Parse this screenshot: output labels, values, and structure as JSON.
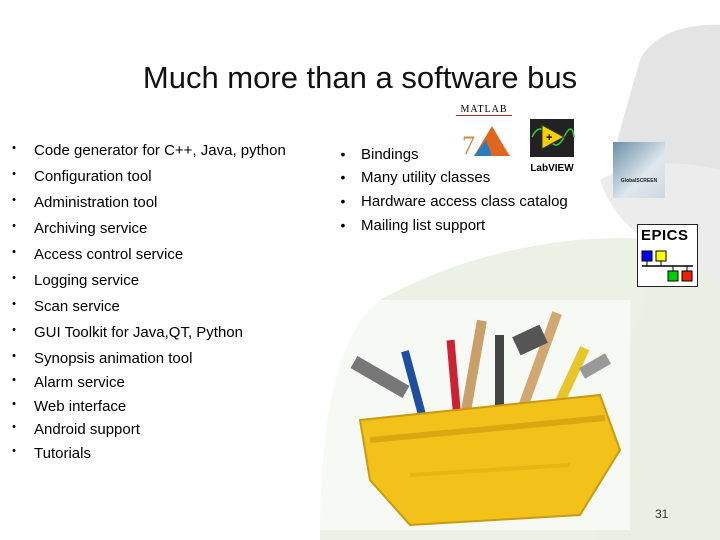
{
  "slide": {
    "title": "Much more than a software bus",
    "left_bullets": [
      "Code generator for C++, Java, python",
      "Configuration tool",
      "Administration tool",
      "Archiving service",
      "Access control service",
      "Logging service",
      "Scan service",
      "GUI Toolkit for Java,QT, Python",
      "Synopsis animation tool",
      "Alarm service",
      "Web interface",
      "Android support",
      "Tutorials"
    ],
    "right_bullets": [
      "Bindings",
      "Many utility classes",
      "Hardware access class catalog",
      "Mailing list support"
    ],
    "logos": {
      "matlab": "MATLAB",
      "labview": "LabVIEW",
      "globalscreen": "GlobalSCREEN",
      "epics": "EPICS"
    },
    "page_number": "31",
    "colors": {
      "bg_gray": "#e3e3e3",
      "bg_green": "#e8eee0",
      "toolbox_yellow": "#f2c21b"
    }
  }
}
